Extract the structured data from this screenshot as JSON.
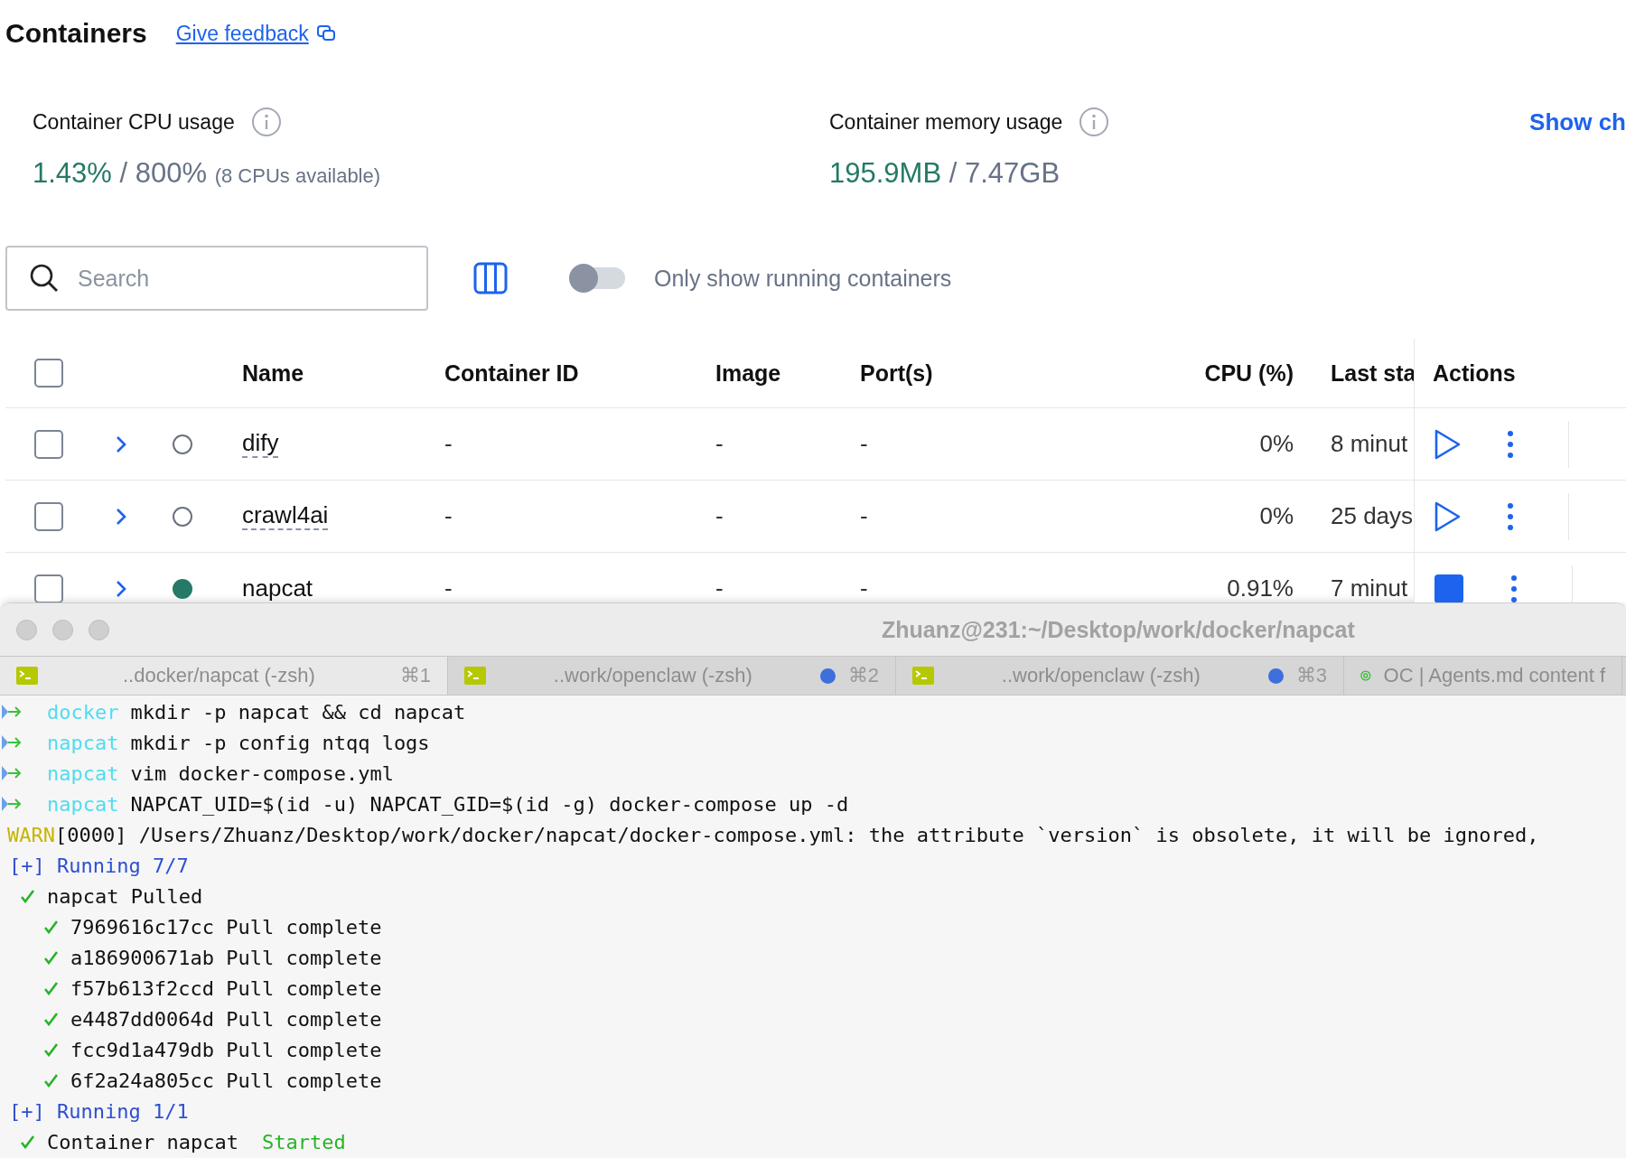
{
  "header": {
    "title": "Containers",
    "feedback_link": "Give feedback"
  },
  "stats": {
    "cpu": {
      "label": "Container CPU usage",
      "used": "1.43%",
      "total": "/ 800%",
      "note": "(8 CPUs available)"
    },
    "memory": {
      "label": "Container memory usage",
      "used": "195.9MB",
      "total": "/ 7.47GB"
    },
    "show_charts": "Show ch"
  },
  "toolbar": {
    "search": {
      "placeholder": "Search"
    },
    "running_only": {
      "label": "Only show running containers",
      "on": false
    }
  },
  "table": {
    "select_all_checked": false,
    "columns": [
      "Name",
      "Container ID",
      "Image",
      "Port(s)",
      "CPU (%)",
      "Last sta",
      "Actions"
    ],
    "rows": [
      {
        "name": "dify",
        "container_id": "-",
        "image": "-",
        "ports": "-",
        "cpu": "0%",
        "last_started": "8 minut",
        "running": false,
        "checked": false,
        "expanded": false
      },
      {
        "name": "crawl4ai",
        "container_id": "-",
        "image": "-",
        "ports": "-",
        "cpu": "0%",
        "last_started": "25 days",
        "running": false,
        "checked": false,
        "expanded": false
      },
      {
        "name": "napcat",
        "container_id": "-",
        "image": "-",
        "ports": "-",
        "cpu": "0.91%",
        "last_started": "7 minut",
        "running": true,
        "checked": false,
        "expanded": false
      }
    ]
  },
  "terminal": {
    "title": "Zhuanz@231:~/Desktop/work/docker/napcat",
    "tabs": [
      {
        "kind": "shell",
        "label": "..docker/napcat (-zsh)",
        "shortcut": "⌘1",
        "activity": false,
        "selected": true
      },
      {
        "kind": "shell",
        "label": "..work/openclaw (-zsh)",
        "shortcut": "⌘2",
        "activity": true,
        "selected": false
      },
      {
        "kind": "shell",
        "label": "..work/openclaw (-zsh)",
        "shortcut": "⌘3",
        "activity": true,
        "selected": false
      },
      {
        "kind": "app",
        "label": "OC | Agents.md content f",
        "selected": false
      }
    ],
    "lines": [
      {
        "kind": "prompt",
        "dir": "docker",
        "command": "mkdir -p napcat && cd napcat"
      },
      {
        "kind": "prompt",
        "dir": "napcat",
        "command": "mkdir -p config ntqq logs"
      },
      {
        "kind": "prompt",
        "dir": "napcat",
        "command": "vim docker-compose.yml"
      },
      {
        "kind": "prompt",
        "dir": "napcat",
        "command": "NAPCAT_UID=$(id -u) NAPCAT_GID=$(id -g) docker-compose up -d"
      },
      {
        "kind": "warn",
        "tag": "WARN",
        "text": "[0000] /Users/Zhuanz/Desktop/work/docker/napcat/docker-compose.yml: the attribute `version` is obsolete, it will be ignored,"
      },
      {
        "kind": "running",
        "text": "[+] Running 7/7"
      },
      {
        "kind": "done",
        "text": "napcat Pulled",
        "children": [
          {
            "kind": "done",
            "text": "7969616c17cc Pull complete"
          },
          {
            "kind": "done",
            "text": "a186900671ab Pull complete"
          },
          {
            "kind": "done",
            "text": "f57b613f2ccd Pull complete"
          },
          {
            "kind": "done",
            "text": "e4487dd0064d Pull complete"
          },
          {
            "kind": "done",
            "text": "fcc9d1a479db Pull complete"
          },
          {
            "kind": "done",
            "text": "6f2a24a805cc Pull complete"
          }
        ]
      },
      {
        "kind": "running",
        "text": "[+] Running 1/1"
      },
      {
        "kind": "done",
        "text": "Container napcat",
        "status": "Started"
      }
    ]
  }
}
